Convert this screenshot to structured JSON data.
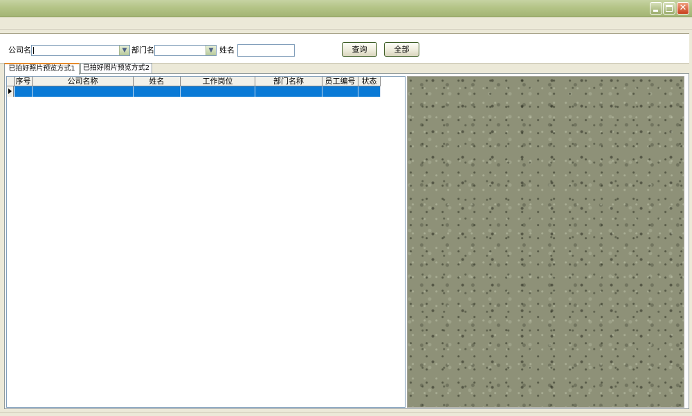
{
  "window": {
    "controls": {
      "minimize": "minimize-icon",
      "maximize": "maximize-icon",
      "close": "close-icon"
    }
  },
  "filters": {
    "company_label": "公司名",
    "company_value": "",
    "department_label": "部门名",
    "department_value": "",
    "name_label": "姓名",
    "name_value": "",
    "query_button": "查询",
    "all_button": "全部"
  },
  "tabs": [
    {
      "label": "已拍好照片预览方式1",
      "active": true
    },
    {
      "label": "已拍好照片预览方式2",
      "active": false
    }
  ],
  "grid": {
    "columns": [
      "序号",
      "公司名称",
      "姓名",
      "工作岗位",
      "部门名称",
      "员工编号",
      "状态"
    ],
    "rows": [
      {
        "selected": true,
        "cells": [
          "",
          "",
          "",
          "",
          "",
          "",
          ""
        ]
      }
    ]
  },
  "colors": {
    "titlebar": "#b4c487",
    "selection": "#0a7ad6",
    "active_tab_accent": "#e68b2c",
    "photo_background": "#8e9178"
  }
}
